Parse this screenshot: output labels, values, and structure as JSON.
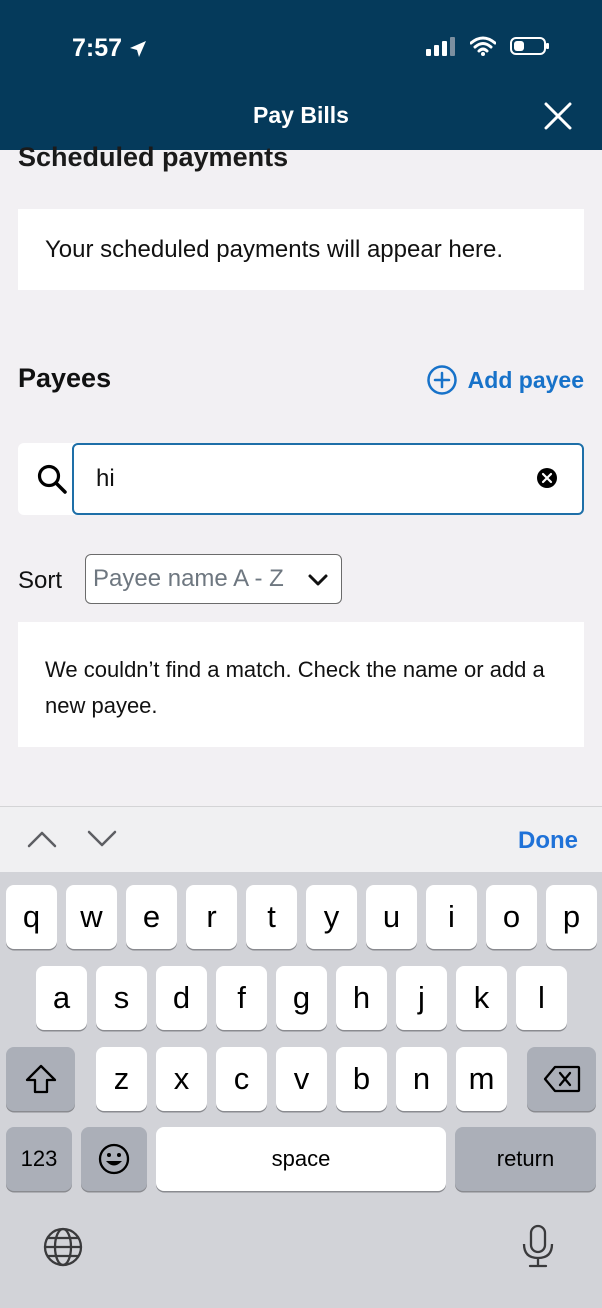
{
  "status_bar": {
    "time": "7:57"
  },
  "header": {
    "title": "Pay Bills",
    "close_icon": "close-icon"
  },
  "scheduled": {
    "title": "Scheduled payments",
    "empty_message": "Your scheduled payments will appear here."
  },
  "payees": {
    "title": "Payees",
    "add_label": "Add payee",
    "search_value": "hi",
    "sort_label": "Sort",
    "sort_value": "Payee name A - Z",
    "no_match_message": "We couldn’t find a match. Check the name or add a new payee."
  },
  "keyboard": {
    "done_label": "Done",
    "row1": [
      "q",
      "w",
      "e",
      "r",
      "t",
      "y",
      "u",
      "i",
      "o",
      "p"
    ],
    "row2": [
      "a",
      "s",
      "d",
      "f",
      "g",
      "h",
      "j",
      "k",
      "l"
    ],
    "row3": [
      "z",
      "x",
      "c",
      "v",
      "b",
      "n",
      "m"
    ],
    "numbers_label": "123",
    "space_label": "space",
    "return_label": "return"
  },
  "colors": {
    "header_bg": "#053a5b",
    "accent": "#1772c9",
    "keyboard_bg": "#d2d3d8"
  }
}
